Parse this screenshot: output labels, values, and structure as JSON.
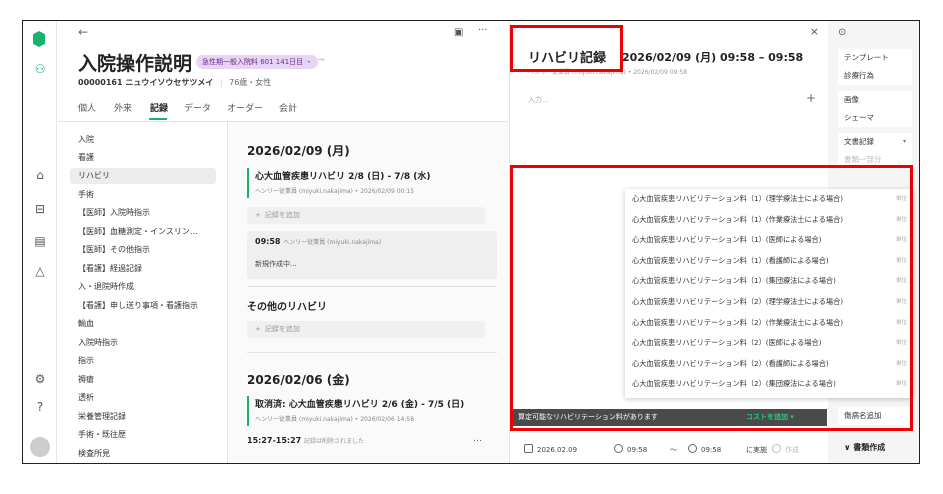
{
  "patient": {
    "title": "入院操作説明",
    "badge": "急性期一般入院料 601 141日目 ・",
    "id_line": "00000161  ニュウイソウセサツメイ",
    "age_sex": "76歳・女性"
  },
  "tabs": [
    {
      "label": "個人"
    },
    {
      "label": "外来"
    },
    {
      "label": "記録",
      "active": true
    },
    {
      "label": "データ"
    },
    {
      "label": "オーダー"
    },
    {
      "label": "会計"
    }
  ],
  "categories": [
    {
      "label": "入院"
    },
    {
      "label": "看護"
    },
    {
      "label": "リハビリ",
      "active": true
    },
    {
      "label": "手術"
    },
    {
      "label": "【医師】入院時指示"
    },
    {
      "label": "【医師】血糖測定・インスリン…"
    },
    {
      "label": "【医師】その他指示"
    },
    {
      "label": "【看護】経過記録"
    },
    {
      "label": "入・退院時作成"
    },
    {
      "label": "【看護】申し送り事項・看護指示"
    },
    {
      "label": "輸血"
    },
    {
      "label": "入院時指示"
    },
    {
      "label": "指示"
    },
    {
      "label": "褥瘡"
    },
    {
      "label": "透析"
    },
    {
      "label": "栄養管理記録"
    },
    {
      "label": "手術・既往歴"
    },
    {
      "label": "検査所見"
    }
  ],
  "timeline": {
    "date1": "2026/02/09 (月)",
    "entry1_title": "心大血管疾患リハビリ 2/8 (日) - 7/8 (水)",
    "entry1_meta": "ヘンリー従業員 (miyuki.nakajima) • 2026/02/09 00:15",
    "add_record": "記録を追加",
    "draft_time": "09:58",
    "draft_author": "ヘンリー従業員 (miyuki.nakajima)",
    "draft_status": "新規作成中...",
    "other_title": "その他のリハビリ",
    "date2": "2026/02/06 (金)",
    "entry2_title": "取消済: 心大血管疾患リハビリ 2/6 (金) - 7/5 (日)",
    "entry2_meta": "ヘンリー従業員 (miyuki.nakajima) • 2026/02/06 14:58",
    "entry3_time": "15:27-15:27",
    "entry3_note": "記録は削除されました",
    "more": "…"
  },
  "record": {
    "title": "リハビリ記録",
    "time": "2026/02/09 (月) 09:58 – 09:58",
    "meta": "ヘンリー従業員 (miyuki.nakajima) • 2026/02/09 09:58",
    "input_placeholder": "入力...",
    "plus": "+",
    "close": "×"
  },
  "dropdown": {
    "items": [
      "心大血管疾患リハビリテーション料（1）(理学療法士による場合)",
      "心大血管疾患リハビリテーション料（1）(作業療法士による場合)",
      "心大血管疾患リハビリテーション料（1）(医師による場合)",
      "心大血管疾患リハビリテーション料（1）(看護師による場合)",
      "心大血管疾患リハビリテーション料（1）(集団療法による場合)",
      "心大血管疾患リハビリテーション料（2）(理学療法士による場合)",
      "心大血管疾患リハビリテーション料（2）(作業療法士による場合)",
      "心大血管疾患リハビリテーション料（2）(医師による場合)",
      "心大血管疾患リハビリテーション料（2）(看護師による場合)",
      "心大血管疾患リハビリテーション料（2）(集団療法による場合)"
    ],
    "unit_label": "単位"
  },
  "cost_bar": {
    "message": "算定可能なリハビリテーション料があります",
    "link": "コストを追加 ▾"
  },
  "bottom": {
    "date": "2026.02.09",
    "start": "09:58",
    "tilde": "～",
    "end": "09:58",
    "implement": "に実施",
    "create": "作成"
  },
  "side": {
    "template": "テンプレート",
    "procedure": "診療行為",
    "image": "画像",
    "schema": "シェーマ",
    "doc_record": "文書記録",
    "doc_chevron": "▾",
    "partial": "書類一部分",
    "disease_add": "傷病名追加",
    "doc_create": "∨ 書類作成"
  },
  "colors": {
    "accent": "#18b26a",
    "highlight": "#e00000",
    "badge_bg": "#e6d4f2"
  }
}
